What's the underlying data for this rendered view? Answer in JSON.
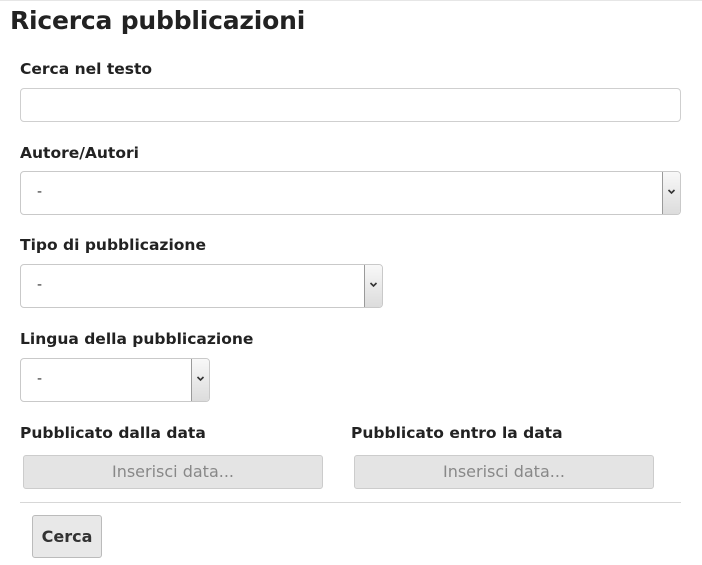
{
  "page": {
    "title": "Ricerca pubblicazioni"
  },
  "form": {
    "text_search": {
      "label": "Cerca nel testo",
      "value": "",
      "placeholder": ""
    },
    "authors": {
      "label": "Autore/Autori",
      "selected": "-"
    },
    "pub_type": {
      "label": "Tipo di pubblicazione",
      "selected": "-"
    },
    "pub_language": {
      "label": "Lingua della pubblicazione",
      "selected": "-"
    },
    "date_from": {
      "label": "Pubblicato dalla data",
      "button": "Inserisci data..."
    },
    "date_to": {
      "label": "Pubblicato entro la data",
      "button": "Inserisci data..."
    },
    "submit_label": "Cerca"
  },
  "icons": {
    "select_arrow": "chevron-down-icon"
  }
}
